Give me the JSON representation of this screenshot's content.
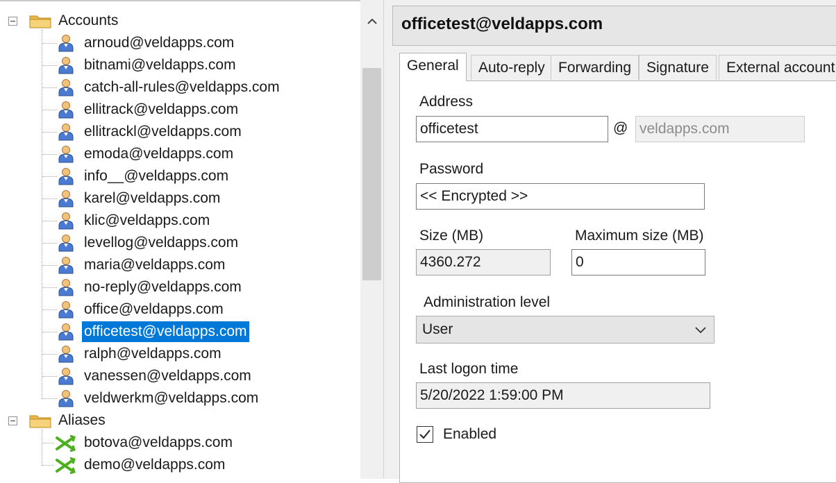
{
  "tree": {
    "accounts_label": "Accounts",
    "aliases_label": "Aliases",
    "accounts": [
      "arnoud@veldapps.com",
      "bitnami@veldapps.com",
      "catch-all-rules@veldapps.com",
      "ellitrack@veldapps.com",
      "ellitrackl@veldapps.com",
      "emoda@veldapps.com",
      "info__@veldapps.com",
      "karel@veldapps.com",
      "klic@veldapps.com",
      "levellog@veldapps.com",
      "maria@veldapps.com",
      "no-reply@veldapps.com",
      "office@veldapps.com",
      "officetest@veldapps.com",
      "ralph@veldapps.com",
      "vanessen@veldapps.com",
      "veldwerkm@veldapps.com"
    ],
    "selected_account": "officetest@veldapps.com",
    "aliases": [
      "botova@veldapps.com",
      "demo@veldapps.com"
    ]
  },
  "detail": {
    "title": "officetest@veldapps.com",
    "tabs": [
      "General",
      "Auto-reply",
      "Forwarding",
      "Signature",
      "External account"
    ],
    "active_tab": "General",
    "address_label": "Address",
    "address_local": "officetest",
    "at_sign": "@",
    "address_domain": "veldapps.com",
    "password_label": "Password",
    "password_value": "<< Encrypted >>",
    "size_label": "Size (MB)",
    "size_value": "4360.272",
    "max_size_label": "Maximum size (MB)",
    "max_size_value": "0",
    "admin_level_label": "Administration level",
    "admin_level_value": "User",
    "last_logon_label": "Last logon time",
    "last_logon_value": "5/20/2022 1:59:00 PM",
    "enabled_label": "Enabled",
    "enabled": true
  },
  "colors": {
    "selection": "#0078d7",
    "folder": "#e8b94a",
    "alias_icon": "#4caf1e"
  }
}
